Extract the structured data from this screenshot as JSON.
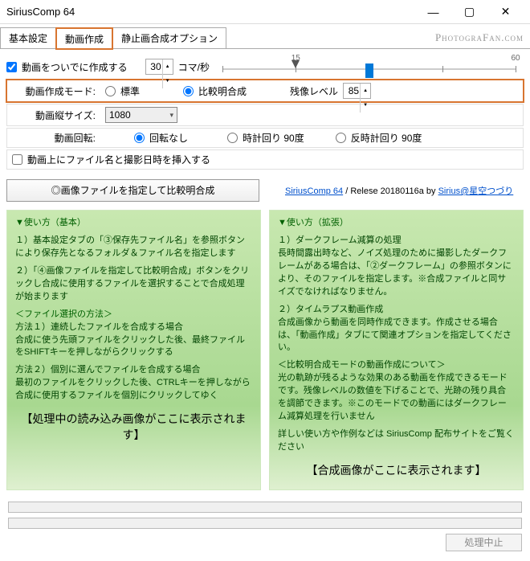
{
  "window": {
    "title": "SiriusComp 64"
  },
  "brand": "PhotograFan.com",
  "tabs": [
    "基本設定",
    "動画作成",
    "静止画合成オプション"
  ],
  "activeTab": 1,
  "row1": {
    "makeAlongside": "動画をついでに作成する",
    "fps": "30",
    "fpsUnit": "コマ/秒",
    "tickLabels": {
      "t15": "15",
      "t60": "60"
    }
  },
  "modeRow": {
    "label": "動画作成モード:",
    "opt1": "標準",
    "opt2": "比較明合成",
    "afterimageLabel": "残像レベル",
    "afterimage": "85"
  },
  "sizeRow": {
    "label": "動画縦サイズ:",
    "value": "1080"
  },
  "rotRow": {
    "label": "動画回転:",
    "opt1": "回転なし",
    "opt2": "時計回り 90度",
    "opt3": "反時計回り 90度"
  },
  "insertRow": {
    "label": "動画上にファイル名と撮影日時を挿入する"
  },
  "bigButton": "◎画像ファイルを指定して比較明合成",
  "release": {
    "link1": "SiriusComp 64",
    "mid": " / Relese 20180116a  by   ",
    "link2": "Sirius@星空つづり"
  },
  "helpLeft": {
    "h": "▼使い方（基本）",
    "p1": "１）基本設定タブの「③保存先ファイル名」を参照ボタンにより保存先となるフォルダ＆ファイル名を指定します",
    "p2": "２）「④画像ファイルを指定して比較明合成」ボタンをクリックし合成に使用するファイルを選択することで合成処理が始まります",
    "p3h": "＜ファイル選択の方法＞",
    "p3": "方法１）連続したファイルを合成する場合\n合成に使う先頭ファイルをクリックした後、最終ファイルをSHIFTキーを押しながらクリックする",
    "p4": "方法２）個別に選んでファイルを合成する場合\n最初のファイルをクリックした後、CTRLキーを押しながら合成に使用するファイルを個別にクリックしてゆく",
    "placeholder": "【処理中の読み込み画像がここに表示されます】"
  },
  "helpRight": {
    "h": "▼使い方（拡張）",
    "p1": "１）ダークフレーム減算の処理\n長時間露出時など、ノイズ処理のために撮影したダークフレームがある場合は、「②ダークフレーム」の参照ボタンにより、そのファイルを指定します。※合成ファイルと同サイズでなければなりません。",
    "p2": "２）タイムラプス動画作成\n合成画像から動画を同時作成できます。作成させる場合は、「動画作成」タブにて関連オプションを指定してください。",
    "p3": "＜比較明合成モードの動画作成について＞\n光の軌跡が残るような効果のある動画を作成できるモードです。残像レベルの数値を下げることで、光跡の残り具合を調節できます。※このモードでの動画にはダークフレーム減算処理を行いません",
    "p4": "詳しい使い方や作例などは SiriusComp 配布サイトをご覧ください",
    "placeholder": "【合成画像がここに表示されます】"
  },
  "stopBtn": "処理中止"
}
